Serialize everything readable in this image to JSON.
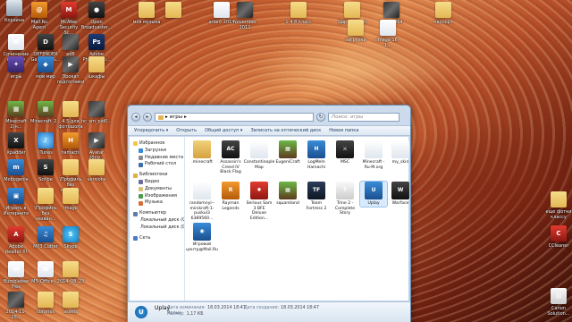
{
  "desktop": {
    "icons": [
      {
        "name": "icon-mail-ru-agent",
        "label": "Mail.Ru Agent",
        "icon": "mail-icon",
        "style": "app-orange",
        "glyph": "@"
      },
      {
        "name": "icon-mcafee",
        "label": "McAfee Security Sc...",
        "icon": "shield-icon",
        "style": "app-red",
        "glyph": "M"
      },
      {
        "name": "icon-open-broadcaster",
        "label": "Open Broadcaster...",
        "icon": "broadcast-icon",
        "style": "app-dark",
        "glyph": "●"
      },
      {
        "name": "icon-sochinenie",
        "label": "Сочинение на тему",
        "icon": "document-icon",
        "style": "doc",
        "glyph": "W"
      },
      {
        "name": "icon-defender",
        "label": "DEFENDER Gamepad&...",
        "icon": "gamepad-icon",
        "style": "app-dark",
        "glyph": "D"
      },
      {
        "name": "icon-ed8",
        "label": "ed8",
        "icon": "image-icon",
        "style": "pic",
        "glyph": ""
      },
      {
        "name": "icon-adobe-photoshop",
        "label": "Adobe Photoshop...",
        "icon": "photoshop-icon",
        "style": "app-ps",
        "glyph": "Ps"
      },
      {
        "name": "icon-igry",
        "label": "игры",
        "icon": "games-icon",
        "style": "app-purple",
        "glyph": "✦"
      },
      {
        "name": "icon-moi-mir",
        "label": "мои мир",
        "icon": "moimir-icon",
        "style": "app-blue",
        "glyph": "◆"
      },
      {
        "name": "icon-prokat",
        "label": "Прокат подготовки",
        "icon": "video-icon",
        "style": "pic",
        "glyph": "▶"
      },
      {
        "name": "icon-shkafy",
        "label": "шкафы",
        "icon": "folder-icon",
        "style": "folder",
        "glyph": ""
      },
      {
        "name": "icon-minecraft-1",
        "label": "Minecraft 2(н... ",
        "icon": "minecraft-icon",
        "style": "app-mc",
        "glyph": "▦"
      },
      {
        "name": "icon-minecraft-2",
        "label": "Minecraft_2...",
        "icon": "minecraft-icon",
        "style": "app-mc",
        "glyph": "▦"
      },
      {
        "name": "icon-fon",
        "label": "4.5 для фотошопа",
        "icon": "folder-icon",
        "style": "folder",
        "glyph": ""
      },
      {
        "name": "icon-hc-sm",
        "label": "hc_sm_pid0...",
        "icon": "image-icon",
        "style": "pic",
        "glyph": ""
      },
      {
        "name": "icon-xpadder",
        "label": "Xpadder",
        "icon": "xpadder-icon",
        "style": "app-dark",
        "glyph": "X"
      },
      {
        "name": "icon-itunes",
        "label": "iTunes",
        "icon": "itunes-icon",
        "style": "app-itunes",
        "glyph": "♪"
      },
      {
        "name": "icon-hamachi",
        "label": "hamachi",
        "icon": "hamachi-icon",
        "style": "app-orange",
        "glyph": "H"
      },
      {
        "name": "icon-avatar",
        "label": "Avatar 2009...",
        "icon": "video-icon",
        "style": "pic",
        "glyph": "▶"
      },
      {
        "name": "icon-mobogenie",
        "label": "Mobogenie",
        "icon": "mobogenie-icon",
        "style": "app-blue",
        "glyph": "m"
      },
      {
        "name": "icon-scribe",
        "label": "Scribe",
        "icon": "scribe-icon",
        "style": "app-dark",
        "glyph": "S"
      },
      {
        "name": "icon-profil",
        "label": "\\Профиль без назван...",
        "icon": "folder-icon",
        "style": "folder",
        "glyph": ""
      },
      {
        "name": "icon-versions",
        "label": "versions",
        "icon": "folder-icon",
        "style": "folder",
        "glyph": ""
      },
      {
        "name": "icon-igrat",
        "label": "Играть в Интернете",
        "icon": "internet-games-icon",
        "style": "app-blue",
        "glyph": "▣"
      },
      {
        "name": "icon-profil-2",
        "label": "\\Профиль без назван...",
        "icon": "folder-icon",
        "style": "folder",
        "glyph": ""
      },
      {
        "name": "icon-image",
        "label": "image",
        "icon": "folder-icon",
        "style": "folder",
        "glyph": ""
      },
      {
        "name": "icon-adobe-reader",
        "label": "Adobe Reader XI",
        "icon": "adobe-reader-icon",
        "style": "app-red",
        "glyph": "A"
      },
      {
        "name": "icon-mp3-cutter",
        "label": "MP3 Cutter",
        "icon": "audio-icon",
        "style": "app-blue",
        "glyph": "♫"
      },
      {
        "name": "icon-skype",
        "label": "Skype",
        "icon": "skype-icon",
        "style": "app-skype",
        "glyph": "S"
      },
      {
        "name": "icon-bumblebee",
        "label": "Bumblebee Free",
        "icon": "document-icon",
        "style": "doc",
        "glyph": "W"
      },
      {
        "name": "icon-ms-office",
        "label": "MS_Office_...",
        "icon": "document-icon",
        "style": "doc",
        "glyph": "W"
      },
      {
        "name": "icon-2014-08",
        "label": "2014_08_23",
        "icon": "folder-icon",
        "style": "folder",
        "glyph": ""
      },
      {
        "name": "icon-2014-11",
        "label": "2014-11-28...",
        "icon": "image-icon",
        "style": "pic",
        "glyph": ""
      },
      {
        "name": "icon-libraries",
        "label": "libraries",
        "icon": "folder-icon",
        "style": "folder",
        "glyph": ""
      },
      {
        "name": "icon-assets",
        "label": "assets",
        "icon": "folder-icon",
        "style": "folder",
        "glyph": ""
      },
      {
        "name": "icon-moya-muzyka",
        "label": "моя музыка",
        "icon": "folder-icon",
        "style": "folder",
        "glyph": ""
      },
      {
        "name": "icon-top-folder",
        "label": "",
        "icon": "folder-icon",
        "style": "folder",
        "glyph": ""
      },
      {
        "name": "icon-ariant",
        "label": "ariant 2014",
        "icon": "document-icon",
        "style": "doc",
        "glyph": ""
      },
      {
        "name": "icon-november",
        "label": "November 2012",
        "icon": "image-icon",
        "style": "pic",
        "glyph": ""
      },
      {
        "name": "icon-class",
        "label": "1-4 8 класс",
        "icon": "folder-icon",
        "style": "folder",
        "glyph": ""
      },
      {
        "name": "icon-tsar",
        "label": "Цар журнал",
        "icon": "folder-icon",
        "style": "folder",
        "glyph": ""
      },
      {
        "name": "icon-potd",
        "label": "Potd 2014",
        "icon": "image-icon",
        "style": "pic",
        "glyph": ""
      },
      {
        "name": "icon-pasport",
        "label": "паспорт",
        "icon": "folder-icon",
        "style": "folder",
        "glyph": ""
      },
      {
        "name": "icon-zagruzki-top",
        "label": "загрузки",
        "icon": "folder-icon",
        "style": "folder",
        "glyph": ""
      },
      {
        "name": "icon-image-16",
        "label": "image 16-1...",
        "icon": "image-icon",
        "style": "doc",
        "glyph": ""
      },
      {
        "name": "icon-fotki",
        "label": "еще фотки классу",
        "icon": "folder-icon",
        "style": "folder",
        "glyph": ""
      },
      {
        "name": "icon-ccleaner",
        "label": "CCleaner",
        "icon": "ccleaner-icon",
        "style": "app-red",
        "glyph": "C"
      },
      {
        "name": "icon-canon",
        "label": "Canon Solution...",
        "icon": "printer-icon",
        "style": "app-white",
        "glyph": "▤"
      },
      {
        "name": "icon-recycle",
        "label": "Корзина",
        "icon": "recycle-bin-icon",
        "style": "bin",
        "glyph": ""
      }
    ]
  },
  "window": {
    "path": [
      "▸",
      "игры",
      "▸"
    ],
    "search_placeholder": "Поиск: игры",
    "toolbar": [
      "Упорядочить ▾",
      "Открыть",
      "Общий доступ ▾",
      "Записать на оптический диск",
      "Новая папка"
    ],
    "nav": [
      {
        "label": "Избранное",
        "level": 1,
        "color": "#f3c84c"
      },
      {
        "label": "Загрузки",
        "level": 2,
        "color": "#3a8cd8"
      },
      {
        "label": "Недавние места",
        "level": 2,
        "color": "#8a8a8a"
      },
      {
        "label": "Рабочий стол",
        "level": 2,
        "color": "#3a6ea8"
      },
      {
        "label": "",
        "level": 0,
        "color": ""
      },
      {
        "label": "Библиотеки",
        "level": 1,
        "color": "#d9b24a"
      },
      {
        "label": "Видео",
        "level": 2,
        "color": "#6b6b9e"
      },
      {
        "label": "Документы",
        "level": 2,
        "color": "#d8c07a"
      },
      {
        "label": "Изображения",
        "level": 2,
        "color": "#4a9a4a"
      },
      {
        "label": "Музыка",
        "level": 2,
        "color": "#d86b3a"
      },
      {
        "label": "",
        "level": 0,
        "color": ""
      },
      {
        "label": "Компьютер",
        "level": 1,
        "color": "#5a7ea8"
      },
      {
        "label": "Локальный диск (C",
        "level": 2,
        "color": "#9aa6b2"
      },
      {
        "label": "Локальный диск (D",
        "level": 2,
        "color": "#9aa6b2"
      },
      {
        "label": "",
        "level": 0,
        "color": ""
      },
      {
        "label": "Сеть",
        "level": 1,
        "color": "#4a7ac8"
      }
    ],
    "files": [
      {
        "label": ".minecraft",
        "style": "folder-w",
        "glyph": "",
        "icon": "folder-icon"
      },
      {
        "label": "Assassin's Creed IV Black Flag",
        "style": "app-dark",
        "glyph": "AC",
        "icon": "assassins-creed-icon"
      },
      {
        "label": "Constantinople Map",
        "style": "doc",
        "glyph": "",
        "icon": "document-icon"
      },
      {
        "label": "EugeniCraft",
        "style": "app-mc",
        "glyph": "▦",
        "icon": "minecraft-icon"
      },
      {
        "label": "LogMeIn Hamachi",
        "style": "app-blue",
        "glyph": "H",
        "icon": "hamachi-icon"
      },
      {
        "label": "MSC",
        "style": "app-dark",
        "glyph": "⚔",
        "icon": "sword-icon"
      },
      {
        "label": "Minecraft - Ru-M.org",
        "style": "doc",
        "glyph": "",
        "icon": "document-icon"
      },
      {
        "label": "my_skin",
        "style": "doc",
        "glyph": "",
        "icon": "image-icon"
      },
      {
        "label": "randomnyi--minikraft-1-puskul3 6389560...",
        "style": "doc",
        "glyph": "",
        "icon": "document-icon"
      },
      {
        "label": "Rayman Legends",
        "style": "app-orange",
        "glyph": "R",
        "icon": "rayman-icon"
      },
      {
        "label": "Serious Sam 3 BFE Deluxe Edition...",
        "style": "app-red",
        "glyph": "✹",
        "icon": "serious-sam-icon"
      },
      {
        "label": "squareland",
        "style": "app-mc",
        "glyph": "▦",
        "icon": "squareland-icon"
      },
      {
        "label": "Team Fortress 2",
        "style": "app-steam",
        "glyph": "TF",
        "icon": "tf2-icon"
      },
      {
        "label": "Trine 2 - Complete Story",
        "style": "app-white",
        "glyph": "T",
        "icon": "trine-icon"
      },
      {
        "label": "Uplay",
        "style": "app-blue",
        "glyph": "U",
        "icon": "uplay-icon",
        "selected": true
      },
      {
        "label": "Warface",
        "style": "app-dark",
        "glyph": "W",
        "icon": "warface-icon"
      },
      {
        "label": "Игровой центр@Mail.Ru",
        "style": "app-blue",
        "glyph": "◉",
        "icon": "game-center-icon"
      }
    ],
    "details": {
      "name": "Uplay",
      "type": "Ярлык",
      "modified_label": "Дата изменения:",
      "modified": "18.03.2014 18:47",
      "created_label": "Дата создания:",
      "created": "18.03.2014 18:47",
      "size_label": "Размер:",
      "size": "1,17 КБ"
    }
  }
}
